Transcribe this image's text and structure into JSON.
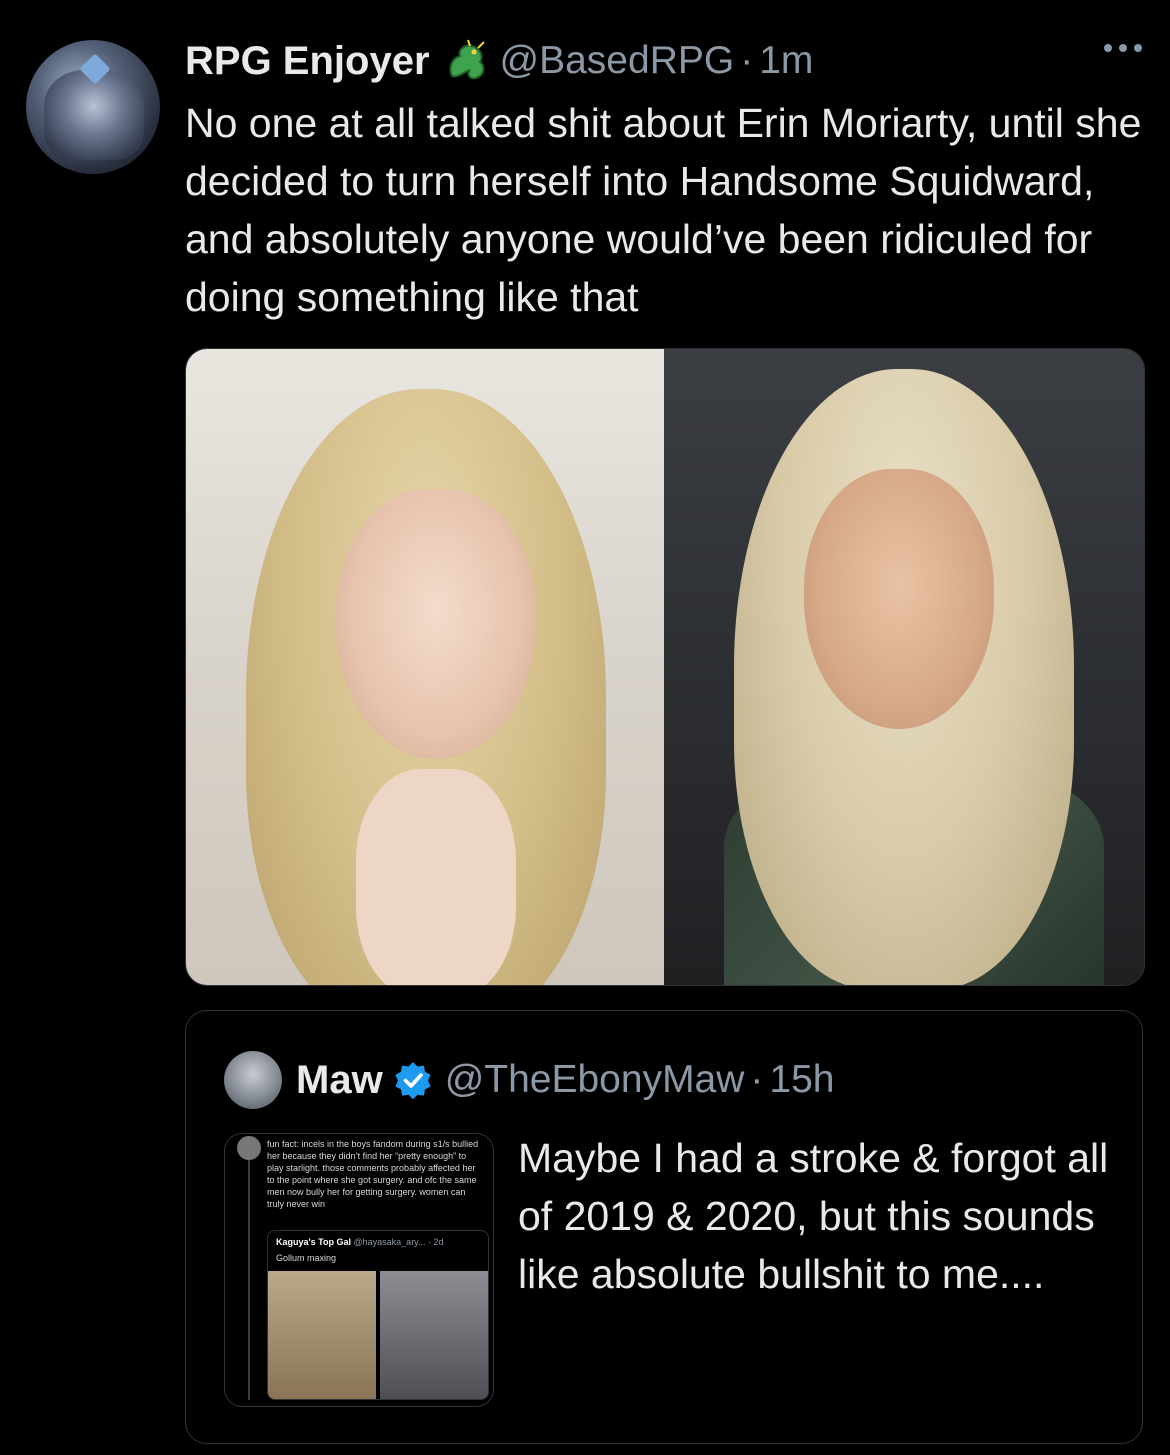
{
  "tweet": {
    "author_name": "RPG Enjoyer",
    "author_emoji": "dragon-emoji",
    "handle": "@BasedRPG",
    "separator": "·",
    "time": "1m",
    "text": "No one at all talked shit about Erin Moriarty, until she decided to turn herself into Handsome Squidward, and absolutely anyone would’ve been ridiculed for doing something like that"
  },
  "quoted_tweet": {
    "author_name": "Maw",
    "verified": true,
    "handle": "@TheEbonyMaw",
    "separator": "·",
    "time": "15h",
    "text": "Maybe I had a stroke & forgot all of 2019 & 2020, but this sounds like absolute bullshit to me....",
    "thumbnail": {
      "text": "fun fact: incels in the boys fandom during s1/s bullied her because they didn’t find her “pretty enough” to play starlight. those comments probably affected her to the point where she got surgery. and ofc the same men now bully her for getting surgery. women can truly never win",
      "inner_author": "Kaguya's Top Gal",
      "inner_handle": "@hayasaka_ary... · 2d",
      "inner_text": "Gollum maxing"
    }
  },
  "colors": {
    "background": "#000000",
    "text": "#e7e9ea",
    "secondary": "#8b98a5",
    "border": "#2f3336",
    "verified": "#1d9bf0"
  }
}
